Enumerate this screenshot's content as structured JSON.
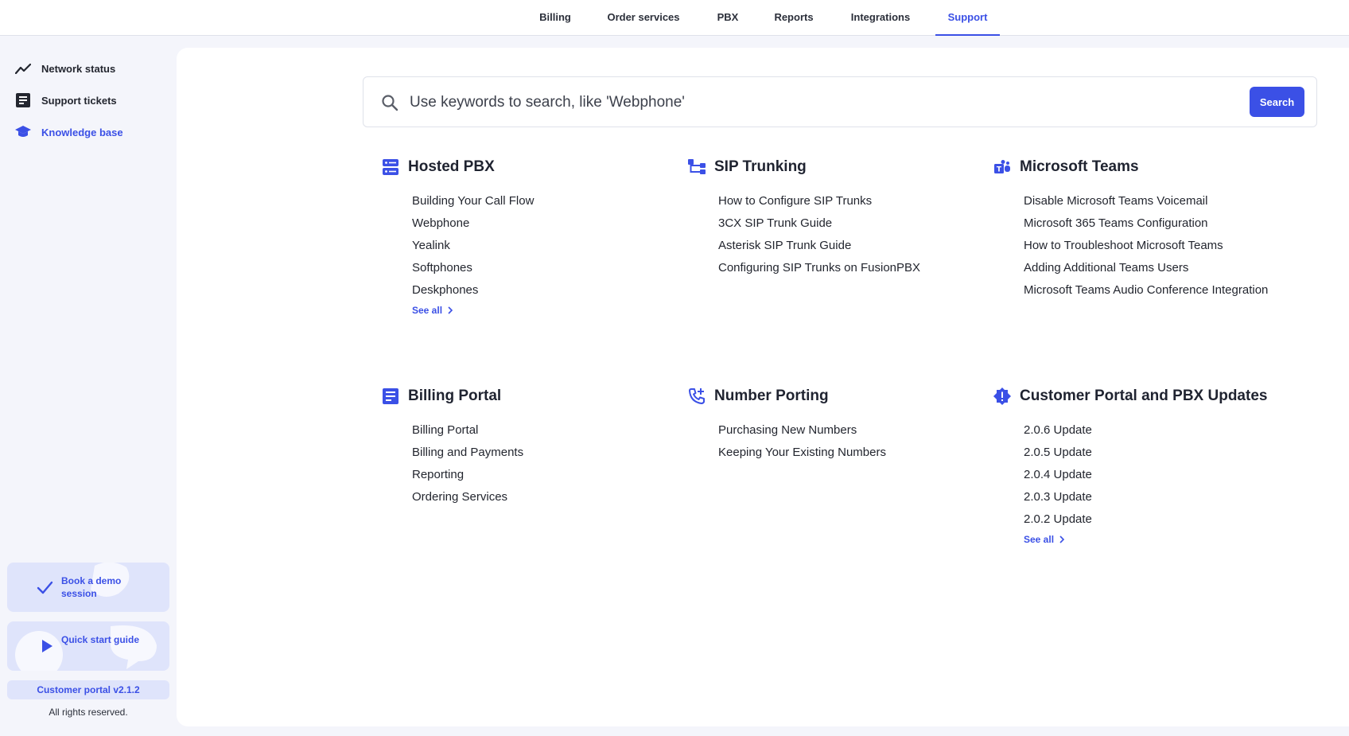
{
  "topnav": {
    "tabs": [
      {
        "label": "Billing",
        "active": false
      },
      {
        "label": "Order services",
        "active": false
      },
      {
        "label": "PBX",
        "active": false
      },
      {
        "label": "Reports",
        "active": false
      },
      {
        "label": "Integrations",
        "active": false
      },
      {
        "label": "Support",
        "active": true
      }
    ]
  },
  "sidebar": {
    "items": [
      {
        "label": "Network status",
        "icon": "trend-line-icon"
      },
      {
        "label": "Support tickets",
        "icon": "document-list-icon"
      },
      {
        "label": "Knowledge base",
        "icon": "graduation-cap-icon",
        "active": true
      }
    ],
    "promos": [
      {
        "label": "Book a demo session",
        "icon": "check-icon"
      },
      {
        "label": "Quick start guide",
        "icon": "play-icon"
      }
    ],
    "version": "Customer portal v2.1.2",
    "rights": "All rights reserved."
  },
  "search": {
    "placeholder": "Use keywords to search, like 'Webphone'",
    "button_label": "Search"
  },
  "sections": [
    {
      "title": "Hosted PBX",
      "icon": "server-icon",
      "links": [
        "Building Your Call Flow",
        "Webphone",
        "Yealink",
        "Softphones",
        "Deskphones"
      ],
      "see_all": "See all"
    },
    {
      "title": "SIP Trunking",
      "icon": "hierarchy-icon",
      "links": [
        "How to Configure SIP Trunks",
        "3CX SIP Trunk Guide",
        "Asterisk SIP Trunk Guide",
        "Configuring SIP Trunks on FusionPBX"
      ]
    },
    {
      "title": "Microsoft Teams",
      "icon": "teams-icon",
      "links": [
        "Disable Microsoft Teams Voicemail",
        "Microsoft 365 Teams Configuration",
        "How to Troubleshoot Microsoft Teams",
        "Adding Additional Teams Users",
        "Microsoft Teams Audio Conference Integration"
      ]
    },
    {
      "title": "Billing Portal",
      "icon": "document-icon",
      "links": [
        "Billing Portal",
        "Billing and Payments",
        "Reporting",
        "Ordering Services"
      ]
    },
    {
      "title": "Number Porting",
      "icon": "phone-add-icon",
      "links": [
        "Purchasing New Numbers",
        "Keeping Your Existing Numbers"
      ]
    },
    {
      "title": "Customer Portal and PBX Updates",
      "icon": "alert-badge-icon",
      "links": [
        "2.0.6 Update",
        "2.0.5 Update",
        "2.0.4 Update",
        "2.0.3 Update",
        "2.0.2 Update"
      ],
      "see_all": "See all"
    }
  ],
  "colors": {
    "accent": "#3b50e6",
    "background": "#f4f5fb",
    "promo_bg": "#dfe4fb"
  }
}
